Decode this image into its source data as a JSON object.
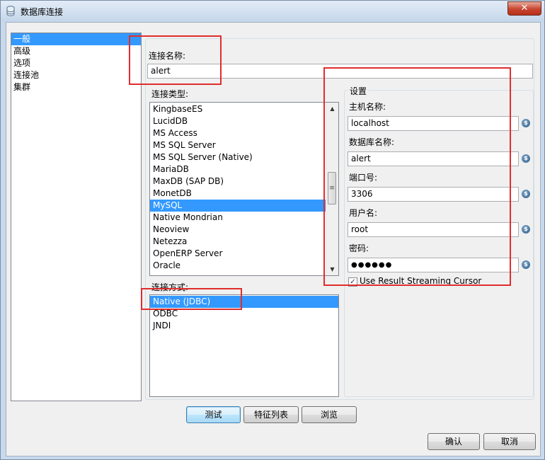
{
  "window": {
    "title": "数据库连接",
    "close_label": "✕"
  },
  "nav": {
    "items": [
      "一般",
      "高级",
      "选项",
      "连接池",
      "集群"
    ],
    "selected": "一般"
  },
  "general": {
    "connection_name_label": "连接名称:",
    "connection_name_value": "alert",
    "connection_type_label": "连接类型:",
    "connection_types": [
      "KingbaseES",
      "LucidDB",
      "MS Access",
      "MS SQL Server",
      "MS SQL Server (Native)",
      "MariaDB",
      "MaxDB (SAP DB)",
      "MonetDB",
      "MySQL",
      "Native Mondrian",
      "Neoview",
      "Netezza",
      "OpenERP Server",
      "Oracle"
    ],
    "selected_type": "MySQL",
    "access_label": "连接方式:",
    "access_methods": [
      "Native (JDBC)",
      "ODBC",
      "JNDI"
    ],
    "selected_access": "Native (JDBC)"
  },
  "settings": {
    "group_title": "设置",
    "host_label": "主机名称:",
    "host_value": "localhost",
    "db_label": "数据库名称:",
    "db_value": "alert",
    "port_label": "端口号:",
    "port_value": "3306",
    "user_label": "用户名:",
    "user_value": "root",
    "password_label": "密码:",
    "password_value": "●●●●●●",
    "streaming_label": "Use Result Streaming Cursor",
    "streaming_checked": true,
    "variable_icon": "$"
  },
  "buttons": {
    "test": "测试",
    "features": "特征列表",
    "browse": "浏览",
    "ok": "确认",
    "cancel": "取消"
  },
  "colors": {
    "selection": "#3399ff",
    "highlight_box": "#e02d2d"
  }
}
